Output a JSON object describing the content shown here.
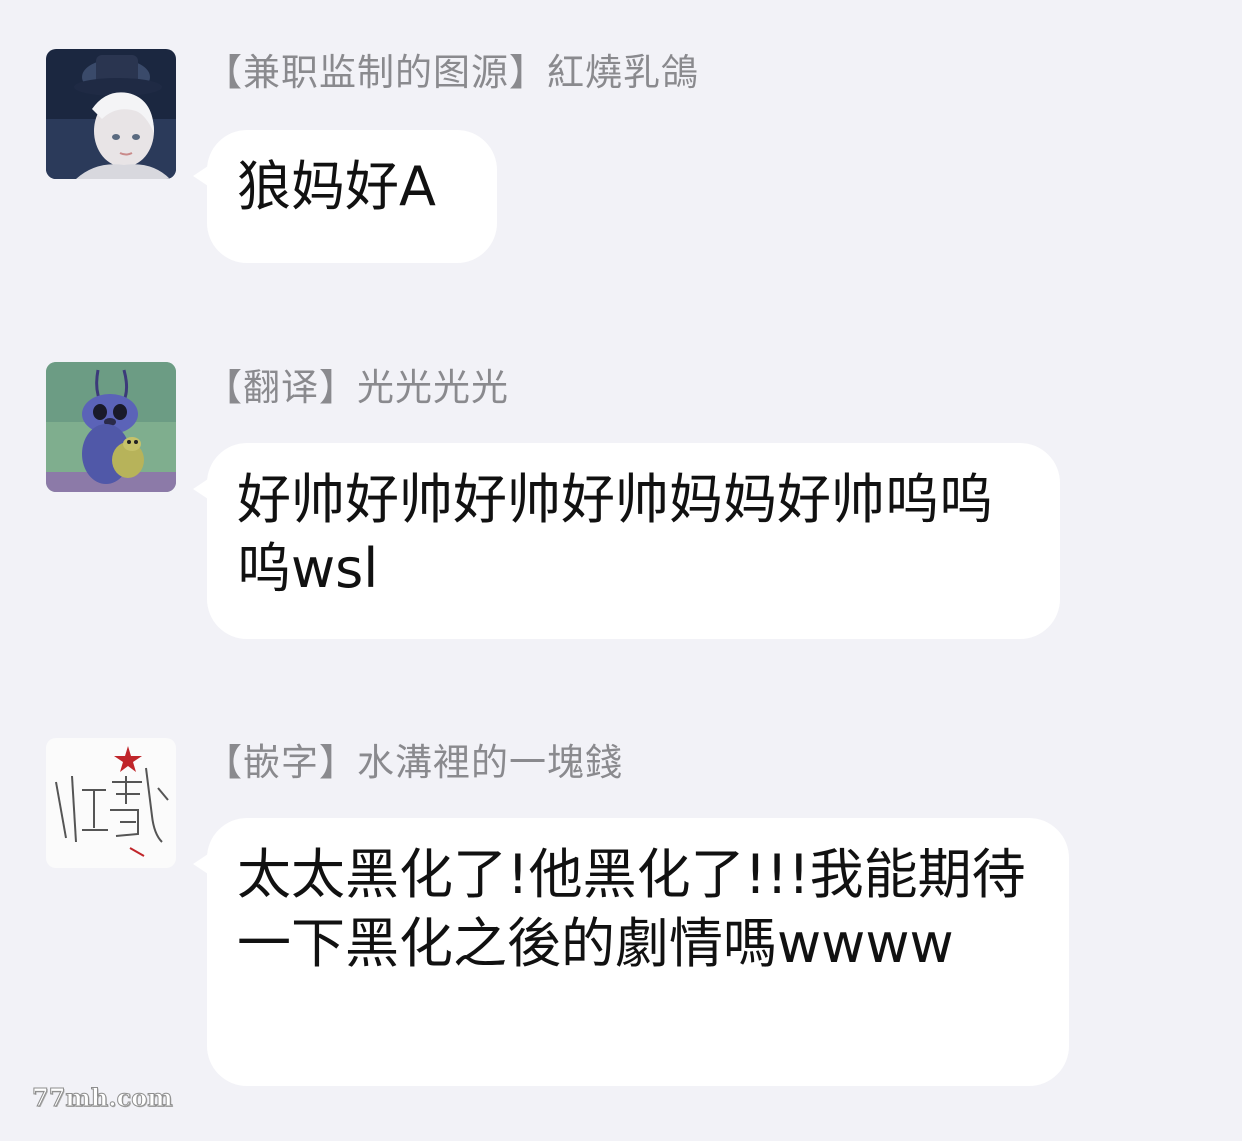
{
  "messages": [
    {
      "sender": "【兼职监制的图源】紅燒乳鴿",
      "text": "狼妈好A",
      "avatar_icon": "dark-hat-character-avatar-icon"
    },
    {
      "sender": "【翻译】光光光光",
      "text": "好帅好帅好帅好帅妈妈好帅呜呜呜wsl",
      "avatar_icon": "blue-alien-cartoon-avatar-icon"
    },
    {
      "sender": "【嵌字】水溝裡的一塊錢",
      "text": "太太黑化了!他黑化了!!!我能期待一下黑化之後的劇情嗎wwww",
      "avatar_icon": "handwritten-signature-avatar-icon"
    }
  ],
  "watermark": "77mh.com",
  "colors": {
    "background": "#f2f2f7",
    "bubble": "#ffffff",
    "sender_text": "#8a8a8e",
    "message_text": "#111111"
  }
}
